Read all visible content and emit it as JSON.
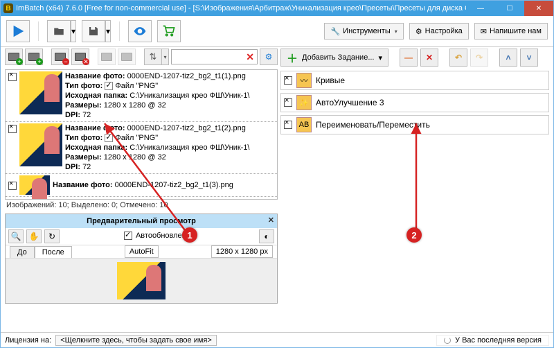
{
  "title": "ImBatch (x64) 7.6.0 [Free for non-commercial use] - [S:\\Изображения\\Арбитраж\\Уникализация крео\\Пресеты\\Пресеты для диска C\\unik_to_ov...",
  "topbuttons": {
    "instruments": "Инструменты",
    "settings": "Настройка",
    "writeus": "Напишите нам"
  },
  "file_labels": {
    "name": "Название фото:",
    "type": "Тип фото:",
    "folder": "Исходная папка:",
    "size": "Размеры:",
    "dpi": "DPI:"
  },
  "files": [
    {
      "name": "0000END-1207-tiz2_bg2_t1(1).png",
      "type": "Файл \"PNG\"",
      "folder": "С:\\Уникализация крео ФШ\\Уник-1\\",
      "size": "1280 x 1280 @ 32",
      "dpi": "72"
    },
    {
      "name": "0000END-1207-tiz2_bg2_t1(2).png",
      "type": "Файл \"PNG\"",
      "folder": "С:\\Уникализация крео ФШ\\Уник-1\\",
      "size": "1280 x 1280 @ 32",
      "dpi": "72"
    },
    {
      "name": "0000END-1207-tiz2_bg2_t1(3).png",
      "type": "",
      "folder": "",
      "size": "",
      "dpi": ""
    }
  ],
  "countbar": "Изображений: 10; Выделено: 0; Отмечено: 10",
  "preview": {
    "title": "Предварительный просмотр",
    "autoupdate": "Автообновление",
    "tab_before": "До",
    "tab_after": "После",
    "fitmode": "AutoFit",
    "dim": "1280 x 1280 px"
  },
  "addtask": "Добавить Задание...",
  "tasks": [
    {
      "label": "Кривые"
    },
    {
      "label": "АвтоУлучшение 3"
    },
    {
      "label": "Переименовать/Переместить"
    }
  ],
  "license_label": "Лицензия на:",
  "license_btn": "<Щелкните здесь, чтобы задать свое имя>",
  "version": "У Вас последняя версия",
  "annotations": {
    "b1": "1",
    "b2": "2"
  }
}
